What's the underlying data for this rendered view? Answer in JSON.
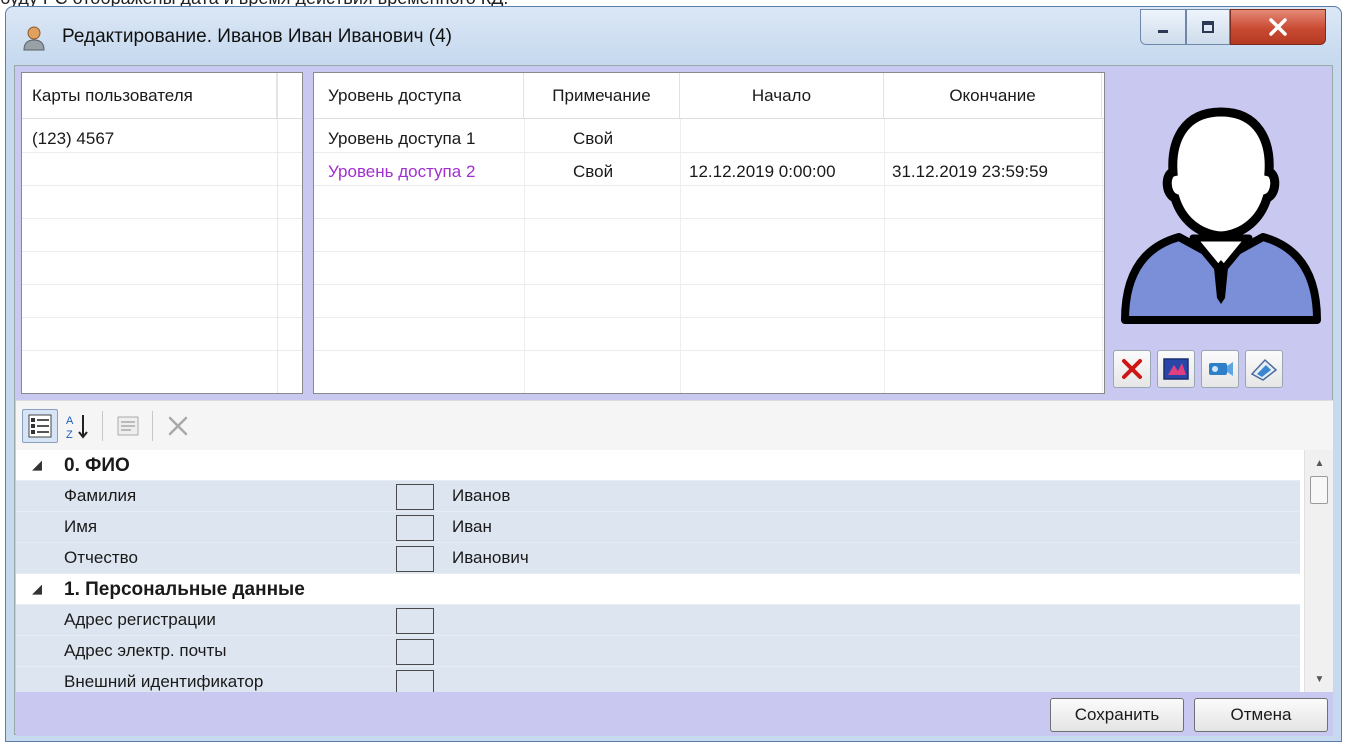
{
  "top_fragment": "буду РС отображены дата и время действия временного КД.",
  "window": {
    "title": "Редактирование. Иванов Иван Иванович (4)",
    "icons": [
      "user-icon",
      "minimize-icon",
      "maximize-icon",
      "close-icon"
    ]
  },
  "cards": {
    "header": "Карты пользователя",
    "items": [
      "(123) 4567"
    ]
  },
  "levels": {
    "headers": [
      "Уровень доступа",
      "Примечание",
      "Начало",
      "Окончание"
    ],
    "rows": [
      {
        "level": "Уровень доступа 1",
        "note": "Свой",
        "start": "",
        "end": "",
        "color": "#1a1a1a"
      },
      {
        "level": "Уровень доступа 2",
        "note": "Свой",
        "start": "12.12.2019 0:00:00",
        "end": "31.12.2019 23:59:59",
        "color": "#a22fd0"
      }
    ]
  },
  "photo": {
    "buttons": [
      "delete-photo-icon",
      "load-photo-icon",
      "camera-icon",
      "scanner-icon"
    ],
    "accent": "#7b8fd8"
  },
  "toolbar": {
    "buttons": [
      "categorized-icon",
      "sort-alpha-icon",
      "property-pages-icon",
      "clear-icon"
    ]
  },
  "properties": {
    "rows": [
      {
        "type": "category",
        "label": "0. ФИО"
      },
      {
        "type": "prop",
        "label": "Фамилия",
        "value": "Иванов"
      },
      {
        "type": "prop",
        "label": "Имя",
        "value": "Иван"
      },
      {
        "type": "prop",
        "label": "Отчество",
        "value": "Иванович"
      },
      {
        "type": "category",
        "label": "1. Персональные данные"
      },
      {
        "type": "prop",
        "label": "Адрес регистрации",
        "value": ""
      },
      {
        "type": "prop",
        "label": "Адрес электр. почты",
        "value": ""
      },
      {
        "type": "prop",
        "label": "Внешний идентификатор",
        "value": ""
      }
    ]
  },
  "footer": {
    "save_label": "Сохранить",
    "cancel_label": "Отмена"
  }
}
